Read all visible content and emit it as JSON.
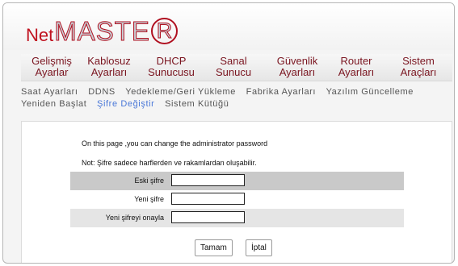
{
  "logo": {
    "net": "Net",
    "master": "MASTE",
    "r": "R"
  },
  "topnav": [
    {
      "line1": "Gelişmiş",
      "line2": "Ayarlar"
    },
    {
      "line1": "Kablosuz",
      "line2": "Ayarları"
    },
    {
      "line1": "DHCP",
      "line2": "Sunucusu"
    },
    {
      "line1": "Sanal",
      "line2": "Sunucu"
    },
    {
      "line1": "Güvenlik",
      "line2": "Ayarları"
    },
    {
      "line1": "Router",
      "line2": "Ayarları"
    },
    {
      "line1": "Sistem",
      "line2": "Araçları"
    }
  ],
  "subnav": [
    "Saat Ayarları",
    "DDNS",
    "Yedekleme/Geri Yükleme",
    "Fabrika Ayarları",
    "Yazılım Güncelleme",
    "Yeniden Başlat",
    "Şifre Değiştir",
    "Sistem Kütüğü"
  ],
  "active_subnav": "Şifre Değiştir",
  "panel": {
    "info1": "On this page ,you can change the administrator password",
    "info2": "Not: Şifre sadece harflerden ve rakamlardan oluşabilir.",
    "fields": [
      {
        "label": "Eski şifre",
        "value": ""
      },
      {
        "label": "Yeni şifre",
        "value": ""
      },
      {
        "label": "Yeni şifreyi onayla",
        "value": ""
      }
    ],
    "ok_label": "Tamam",
    "cancel_label": "İptal"
  },
  "colors": {
    "brand_red": "#c0121f",
    "nav_text": "#7a1520",
    "active_link": "#4a78d8"
  }
}
